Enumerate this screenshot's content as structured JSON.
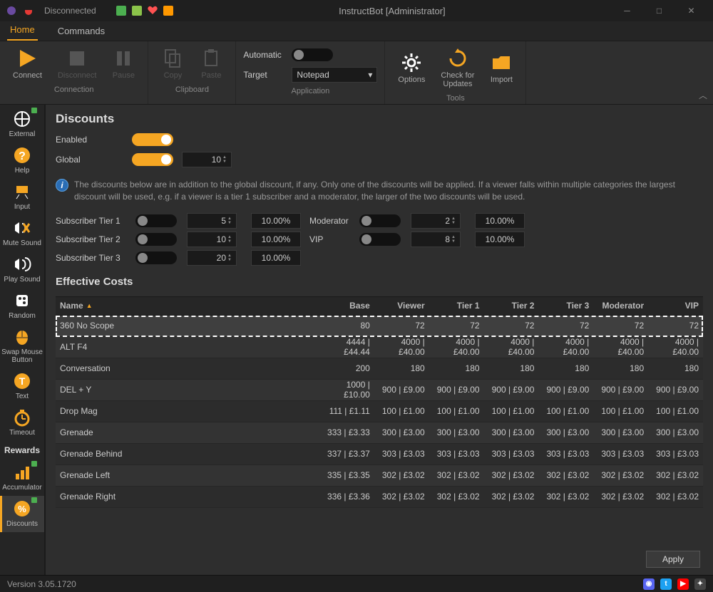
{
  "titlebar": {
    "status": "Disconnected",
    "title": "InstructBot [Administrator]"
  },
  "menu": {
    "tabs": [
      "Home",
      "Commands"
    ],
    "active": 0
  },
  "ribbon": {
    "connection": {
      "label": "Connection",
      "connect": "Connect",
      "disconnect": "Disconnect",
      "pause": "Pause"
    },
    "clipboard": {
      "label": "Clipboard",
      "copy": "Copy",
      "paste": "Paste"
    },
    "application": {
      "label": "Application",
      "automatic_label": "Automatic",
      "automatic_on": false,
      "target_label": "Target",
      "target_value": "Notepad"
    },
    "tools": {
      "label": "Tools",
      "options": "Options",
      "check": "Check for\nUpdates",
      "import": "Import"
    }
  },
  "sidebar": {
    "items": [
      {
        "label": "External",
        "dot": true
      },
      {
        "label": "Help"
      },
      {
        "label": "Input"
      },
      {
        "label": "Mute Sound"
      },
      {
        "label": "Play Sound"
      },
      {
        "label": "Random"
      },
      {
        "label": "Swap Mouse\nButton"
      },
      {
        "label": "Text"
      },
      {
        "label": "Timeout"
      },
      {
        "label": "Rewards",
        "active": false,
        "header": true
      },
      {
        "label": "Accumulator",
        "dot": true
      },
      {
        "label": "Discounts",
        "active": true,
        "dot": true
      }
    ]
  },
  "discounts": {
    "heading": "Discounts",
    "enabled_label": "Enabled",
    "enabled_on": true,
    "global_label": "Global",
    "global_on": true,
    "global_value": "10",
    "info": "The discounts below are in addition to the global discount, if any. Only one of the discounts will be applied. If a viewer falls within multiple categories the largest discount will be used, e.g. if a viewer is a tier 1 subscriber and a moderator, the larger of the two discounts will be used.",
    "rows": [
      {
        "label": "Subscriber Tier 1",
        "on": false,
        "val": "5",
        "pct": "10.00%",
        "label2": "Moderator",
        "on2": false,
        "val2": "2",
        "pct2": "10.00%"
      },
      {
        "label": "Subscriber Tier 2",
        "on": false,
        "val": "10",
        "pct": "10.00%",
        "label2": "VIP",
        "on2": false,
        "val2": "8",
        "pct2": "10.00%"
      },
      {
        "label": "Subscriber Tier 3",
        "on": false,
        "val": "20",
        "pct": "10.00%"
      }
    ]
  },
  "costs": {
    "heading": "Effective Costs",
    "columns": [
      "Name",
      "Base",
      "Viewer",
      "Tier 1",
      "Tier 2",
      "Tier 3",
      "Moderator",
      "VIP"
    ],
    "rows": [
      {
        "name": "360 No Scope",
        "v": [
          "80",
          "72",
          "72",
          "72",
          "72",
          "72",
          "72"
        ],
        "selected": true
      },
      {
        "name": "ALT F4",
        "v": [
          "4444 | £44.44",
          "4000 | £40.00",
          "4000 | £40.00",
          "4000 | £40.00",
          "4000 | £40.00",
          "4000 | £40.00",
          "4000 | £40.00"
        ]
      },
      {
        "name": "Conversation",
        "v": [
          "200",
          "180",
          "180",
          "180",
          "180",
          "180",
          "180"
        ]
      },
      {
        "name": "DEL + Y",
        "v": [
          "1000 | £10.00",
          "900 | £9.00",
          "900 | £9.00",
          "900 | £9.00",
          "900 | £9.00",
          "900 | £9.00",
          "900 | £9.00"
        ]
      },
      {
        "name": "Drop Mag",
        "v": [
          "111 | £1.11",
          "100 | £1.00",
          "100 | £1.00",
          "100 | £1.00",
          "100 | £1.00",
          "100 | £1.00",
          "100 | £1.00"
        ]
      },
      {
        "name": "Grenade",
        "v": [
          "333 | £3.33",
          "300 | £3.00",
          "300 | £3.00",
          "300 | £3.00",
          "300 | £3.00",
          "300 | £3.00",
          "300 | £3.00"
        ]
      },
      {
        "name": "Grenade Behind",
        "v": [
          "337 | £3.37",
          "303 | £3.03",
          "303 | £3.03",
          "303 | £3.03",
          "303 | £3.03",
          "303 | £3.03",
          "303 | £3.03"
        ]
      },
      {
        "name": "Grenade Left",
        "v": [
          "335 | £3.35",
          "302 | £3.02",
          "302 | £3.02",
          "302 | £3.02",
          "302 | £3.02",
          "302 | £3.02",
          "302 | £3.02"
        ]
      },
      {
        "name": "Grenade Right",
        "v": [
          "336 | £3.36",
          "302 | £3.02",
          "302 | £3.02",
          "302 | £3.02",
          "302 | £3.02",
          "302 | £3.02",
          "302 | £3.02"
        ]
      }
    ],
    "apply": "Apply"
  },
  "statusbar": {
    "version": "Version 3.05.1720"
  }
}
